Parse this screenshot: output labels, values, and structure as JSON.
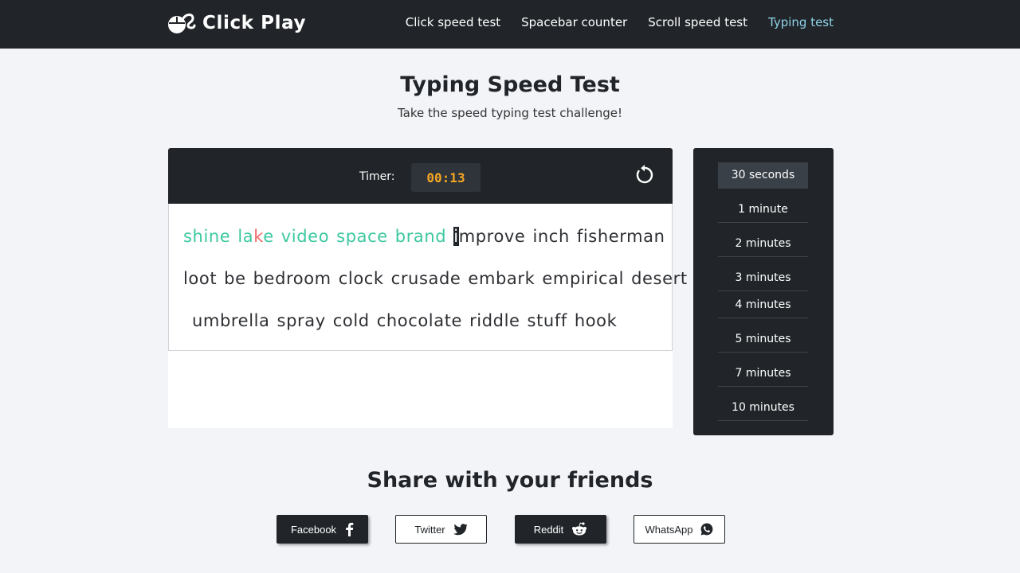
{
  "brand": {
    "name": "Click Play",
    "icon": "mouse-logo-icon"
  },
  "nav": {
    "links": [
      {
        "label": "Click speed test"
      },
      {
        "label": "Spacebar counter"
      },
      {
        "label": "Scroll speed test"
      },
      {
        "label": "Typing test",
        "active": true
      }
    ]
  },
  "page": {
    "title": "Typing Speed Test",
    "subtitle": "Take the speed typing test challenge!"
  },
  "test": {
    "timer_label": "Timer:",
    "timer_value": "00:13",
    "reset_icon": "reset-icon",
    "typed_words": [
      "shine",
      "lake",
      "video",
      "space",
      "brand"
    ],
    "error_word": {
      "before": "la",
      "wrong": "k",
      "after": "e"
    },
    "current_word": {
      "cursor": "i",
      "rest": "mprove"
    },
    "line1_pending": [
      "inch",
      "fisherman"
    ],
    "line2": [
      "loot",
      "be",
      "bedroom",
      "clock",
      "crusade",
      "embark",
      "empirical",
      "desert"
    ],
    "line3": [
      "umbrella",
      "spray",
      "cold",
      "chocolate",
      "riddle",
      "stuff",
      "hook"
    ]
  },
  "durations": [
    {
      "label": "30 seconds",
      "active": true
    },
    {
      "label": "1 minute"
    },
    {
      "label": "2 minutes"
    },
    {
      "label": "3 minutes"
    },
    {
      "label": "4 minutes"
    },
    {
      "label": "5 minutes"
    },
    {
      "label": "7 minutes"
    },
    {
      "label": "10 minutes"
    }
  ],
  "share": {
    "title": "Share with your friends",
    "buttons": [
      {
        "label": "Facebook",
        "icon": "facebook-icon"
      },
      {
        "label": "Twitter",
        "icon": "twitter-icon"
      },
      {
        "label": "Reddit",
        "icon": "reddit-icon"
      },
      {
        "label": "WhatsApp",
        "icon": "whatsapp-icon"
      }
    ]
  },
  "colors": {
    "dark": "#212529",
    "correct": "#3cc8a0",
    "wrong": "#f06b6b",
    "timer": "#f5a623",
    "active_nav": "#8fd3e8"
  }
}
